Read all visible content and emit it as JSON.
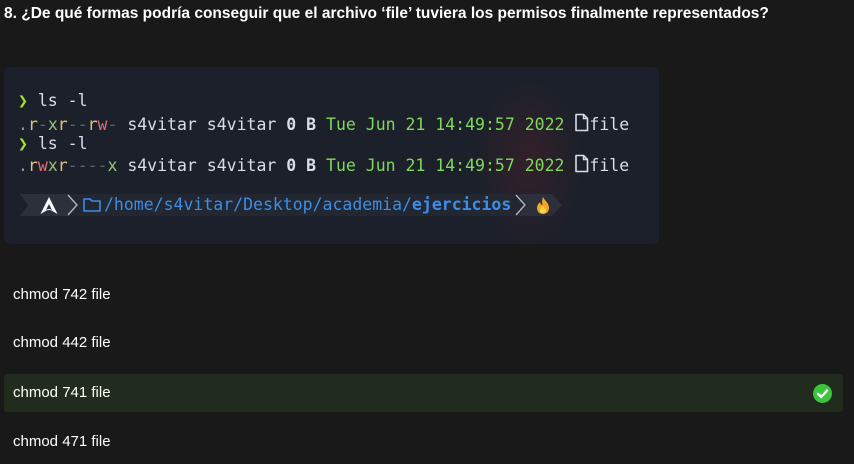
{
  "question": {
    "text": "8. ¿De qué formas podría conseguir que el archivo ‘file’ tuviera los permisos finalmente representados?"
  },
  "terminal": {
    "prompt_symbol": "❯",
    "cmd1": "ls -l",
    "cmd2": "ls -l",
    "row1": {
      "perms": ".r-xr--rw-",
      "user": "s4vitar",
      "group": "s4vitar",
      "size": "0 B",
      "date": "Tue Jun 21 14:49:57 2022",
      "name": "file"
    },
    "row2": {
      "perms": ".rwxr----x",
      "user": "s4vitar",
      "group": "s4vitar",
      "size": "0 B",
      "date": "Tue Jun 21 14:49:57 2022",
      "name": "file"
    },
    "path": {
      "prefix": "/home/s4vitar/Desktop/academia/",
      "last": "ejercicios"
    }
  },
  "options": [
    {
      "label": "chmod 742 file",
      "correct": false
    },
    {
      "label": "chmod 442 file",
      "correct": false
    },
    {
      "label": "chmod 741 file",
      "correct": true
    },
    {
      "label": "chmod 471 file",
      "correct": false
    }
  ],
  "colors": {
    "accent_correct": "#3ec33e",
    "selected_bg": "#212b1e",
    "terminal_bg": "#1c202a"
  }
}
